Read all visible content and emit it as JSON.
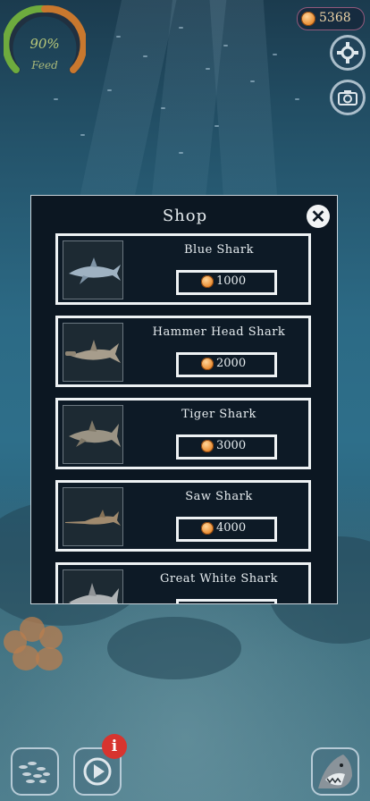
{
  "hud": {
    "feed_percent": "90%",
    "feed_label": "Feed",
    "feed_level": 0.9,
    "coins": "5368"
  },
  "icons": {
    "settings": "gear-icon",
    "camera": "camera-icon",
    "close": "close-icon",
    "coin": "coin-icon",
    "school_of_fish": "fish-school-icon",
    "play": "play-icon",
    "info": "info-icon",
    "shark": "shark-icon"
  },
  "shop": {
    "title": "Shop",
    "close_label": "✕",
    "items": [
      {
        "name": "Blue Shark",
        "price": "1000"
      },
      {
        "name": "Hammer Head Shark",
        "price": "2000"
      },
      {
        "name": "Tiger Shark",
        "price": "3000"
      },
      {
        "name": "Saw Shark",
        "price": "4000"
      },
      {
        "name": "Great White Shark",
        "price": ""
      }
    ]
  },
  "badges": {
    "info": "i"
  },
  "colors": {
    "dialog_bg": "#0c1722",
    "border": "#eef2f4",
    "coin": "#e8872a",
    "badge": "#d7342f"
  }
}
